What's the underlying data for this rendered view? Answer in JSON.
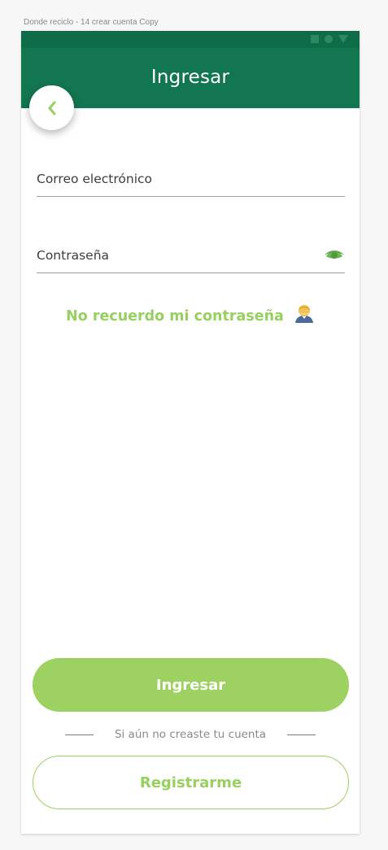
{
  "artboard": {
    "title": "Donde reciclo - 14 crear cuenta Copy"
  },
  "colors": {
    "primary_dark": "#0e6d48",
    "primary": "#127650",
    "accent": "#9dd162",
    "accent_text": "#98d060"
  },
  "header": {
    "title": "Ingresar",
    "back_icon": "chevron-left-icon"
  },
  "form": {
    "email": {
      "label": "Correo electrónico",
      "value": ""
    },
    "password": {
      "label": "Contraseña",
      "value": "",
      "toggle_icon": "eye-icon"
    },
    "forgot_password": {
      "label": "No recuerdo mi contraseña",
      "emoji_icon": "person-face-palm-emoji"
    }
  },
  "actions": {
    "login_label": "Ingresar",
    "divider_text": "Si aún no creaste tu cuenta",
    "register_label": "Registrarme"
  }
}
